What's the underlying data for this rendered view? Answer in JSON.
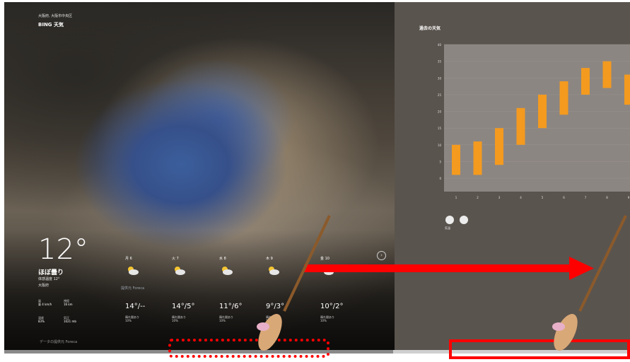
{
  "location_line": "大阪府, 大阪市中央区",
  "app_name": "BING 天気",
  "current": {
    "temp": "12°",
    "condition": "ほぼ曇り",
    "feels_like": "体感温度 12°",
    "sub": "大阪府"
  },
  "stats": [
    {
      "label": "風",
      "value": "東 4 km/h"
    },
    {
      "label": "視程",
      "value": "16 km"
    },
    {
      "label": "湿度",
      "value": "83%"
    },
    {
      "label": "気圧",
      "value": "1021 mb"
    }
  ],
  "forecast": [
    {
      "day": "月 6",
      "temp": "14°/--",
      "desc": "晴れ間あり\n10%"
    },
    {
      "day": "火 7",
      "temp": "14°/5°",
      "desc": "晴れ間あり\n10%"
    },
    {
      "day": "水 8",
      "temp": "11°/6°",
      "desc": "晴れ間あり\n10%"
    },
    {
      "day": "木 9",
      "temp": "9°/3°",
      "desc": "晴れ間あり\n10%"
    },
    {
      "day": "金 10",
      "temp": "10°/2°",
      "desc": "晴れ間あり\n10%"
    }
  ],
  "forecast_note": "提供元 Foreca",
  "footer_note": "データの提供元 Foreca",
  "nav_button": "›",
  "chart_panel": {
    "title": "過去の天気",
    "icon_label": "気温"
  },
  "chart_data": {
    "type": "bar",
    "subtype": "floating-range",
    "title": "過去の天気",
    "categories": [
      "1",
      "2",
      "3",
      "4",
      "5",
      "6",
      "7",
      "8",
      "9"
    ],
    "ranges": [
      [
        1,
        10
      ],
      [
        1,
        11
      ],
      [
        4,
        15
      ],
      [
        10,
        21
      ],
      [
        15,
        25
      ],
      [
        19,
        29
      ],
      [
        25,
        33
      ],
      [
        27,
        35
      ],
      [
        22,
        31
      ]
    ],
    "ylim": [
      -4,
      40
    ],
    "yticks": [
      "40",
      "35",
      "30",
      "25",
      "20",
      "15",
      "10",
      "5",
      "0"
    ],
    "bar_color": "#f39a1f",
    "plot_bg": "#8c8682",
    "grid": true
  },
  "colors": {
    "annotation": "#ff0000",
    "chart_bar": "#f39a1f"
  },
  "icons": [
    "partly-cloudy-icon",
    "temperature-icon",
    "drop-icon"
  ]
}
